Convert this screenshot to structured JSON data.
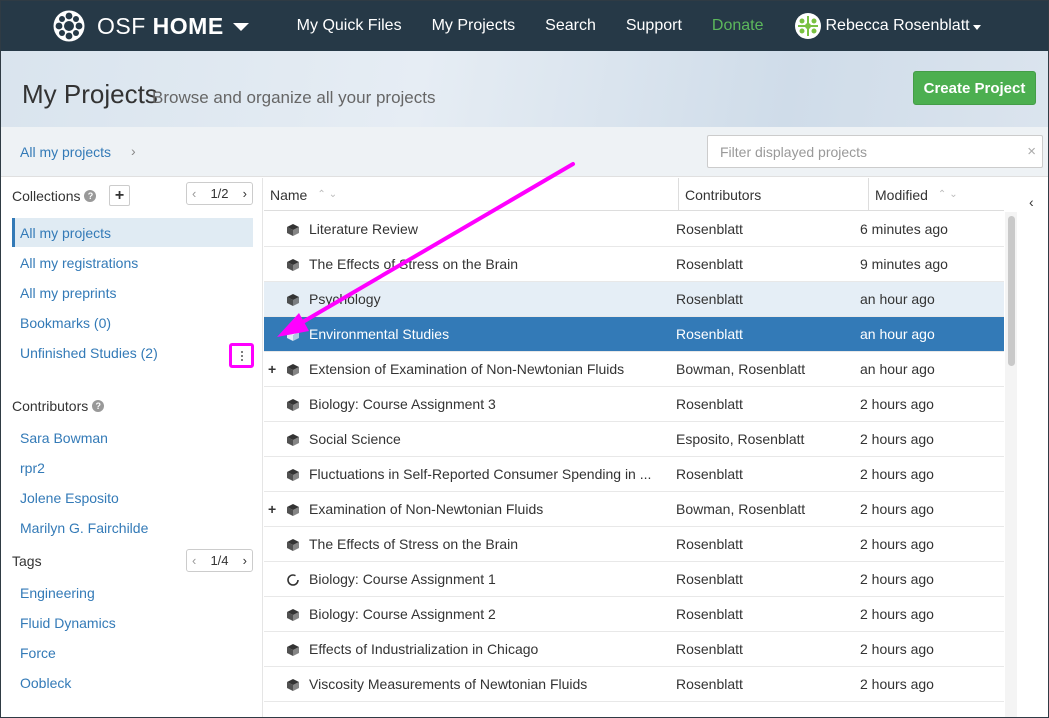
{
  "navbar": {
    "brand": {
      "prefix": "OSF",
      "strong": "HOME"
    },
    "items": [
      {
        "label": "My Quick Files"
      },
      {
        "label": "My Projects"
      },
      {
        "label": "Search"
      },
      {
        "label": "Support"
      },
      {
        "label": "Donate"
      }
    ],
    "user_name": "Rebecca Rosenblatt",
    "colors": {
      "bg": "#263947",
      "donate": "#5cb85c"
    }
  },
  "header": {
    "title": "My Projects",
    "subtitle": "Browse and organize all your projects",
    "create_button": "Create Project"
  },
  "breadcrumb": {
    "current": "All my projects",
    "separator": "›"
  },
  "filter": {
    "placeholder": "Filter displayed projects",
    "value": "",
    "clear_icon": "×"
  },
  "sidebar": {
    "collections": {
      "heading": "Collections",
      "help_icon": "?",
      "add_icon": "+",
      "pager": "1/2",
      "items": [
        {
          "label": "All my projects",
          "selected": true
        },
        {
          "label": "All my registrations"
        },
        {
          "label": "All my preprints"
        },
        {
          "label": "Bookmarks (0)"
        },
        {
          "label": "Unfinished Studies (2)"
        }
      ]
    },
    "contributors": {
      "heading": "Contributors",
      "help_icon": "?",
      "items": [
        {
          "label": "Sara Bowman"
        },
        {
          "label": "rpr2"
        },
        {
          "label": "Jolene Esposito"
        },
        {
          "label": "Marilyn G. Fairchilde"
        }
      ]
    },
    "tags": {
      "heading": "Tags",
      "pager": "1/4",
      "items": [
        {
          "label": "Engineering"
        },
        {
          "label": "Fluid Dynamics"
        },
        {
          "label": "Force"
        },
        {
          "label": "Oobleck"
        }
      ]
    }
  },
  "table": {
    "columns": [
      {
        "label": "Name"
      },
      {
        "label": "Contributors"
      },
      {
        "label": "Modified"
      }
    ],
    "rows": [
      {
        "expand": "",
        "icon": "cube",
        "name": "Literature Review",
        "contributors": "Rosenblatt",
        "modified": "6 minutes ago"
      },
      {
        "expand": "",
        "icon": "cube",
        "name": "The Effects of Stress on the Brain",
        "contributors": "Rosenblatt",
        "modified": "9 minutes ago"
      },
      {
        "expand": "",
        "icon": "cube",
        "name": "Psychology",
        "contributors": "Rosenblatt",
        "modified": "an hour ago",
        "state": "hover"
      },
      {
        "expand": "",
        "icon": "cube",
        "name": "Environmental Studies",
        "contributors": "Rosenblatt",
        "modified": "an hour ago",
        "state": "selected"
      },
      {
        "expand": "+",
        "icon": "cube",
        "name": "Extension of Examination of Non-Newtonian Fluids",
        "contributors": "Bowman, Rosenblatt",
        "modified": "an hour ago"
      },
      {
        "expand": "",
        "icon": "cube",
        "name": "Biology: Course Assignment 3",
        "contributors": "Rosenblatt",
        "modified": "2 hours ago"
      },
      {
        "expand": "",
        "icon": "cube",
        "name": "Social Science",
        "contributors": "Esposito, Rosenblatt",
        "modified": "2 hours ago"
      },
      {
        "expand": "",
        "icon": "cube",
        "name": "Fluctuations in Self-Reported Consumer Spending in ...",
        "contributors": "Rosenblatt",
        "modified": "2 hours ago"
      },
      {
        "expand": "+",
        "icon": "cube",
        "name": "Examination of Non-Newtonian Fluids",
        "contributors": "Bowman, Rosenblatt",
        "modified": "2 hours ago"
      },
      {
        "expand": "",
        "icon": "cube",
        "name": "The Effects of Stress on the Brain",
        "contributors": "Rosenblatt",
        "modified": "2 hours ago"
      },
      {
        "expand": "",
        "icon": "spinner",
        "name": "Biology: Course Assignment 1",
        "contributors": "Rosenblatt",
        "modified": "2 hours ago"
      },
      {
        "expand": "",
        "icon": "cube",
        "name": "Biology: Course Assignment 2",
        "contributors": "Rosenblatt",
        "modified": "2 hours ago"
      },
      {
        "expand": "",
        "icon": "cube",
        "name": "Effects of Industrialization in Chicago",
        "contributors": "Rosenblatt",
        "modified": "2 hours ago"
      },
      {
        "expand": "",
        "icon": "cube",
        "name": "Viscosity Measurements of Newtonian Fluids",
        "contributors": "Rosenblatt",
        "modified": "2 hours ago"
      }
    ],
    "colors": {
      "selected": "#337ab7",
      "hover": "#e5eef6"
    }
  },
  "annotation": {
    "color": "#ff00ff"
  }
}
